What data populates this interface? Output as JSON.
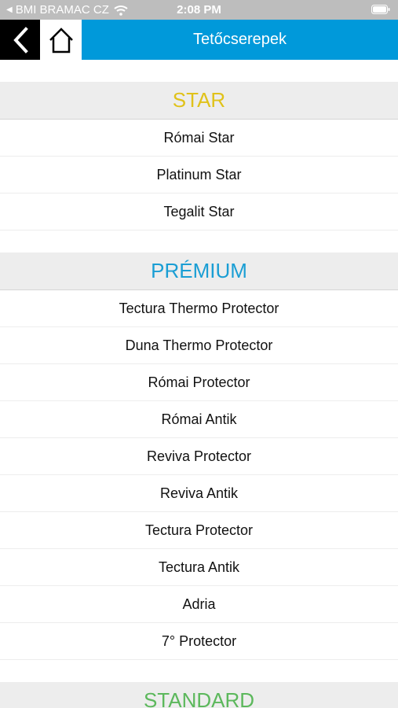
{
  "status_bar": {
    "carrier": "BMI BRAMAC CZ",
    "time": "2:08 PM"
  },
  "nav": {
    "title": "Tetőcserepek",
    "icons": [
      "chevron-left-icon",
      "home-icon"
    ]
  },
  "colors": {
    "accent": "#0099da",
    "star": "#e0c21a",
    "premium": "#1a9ed4",
    "standard": "#5cb85c"
  },
  "sections": [
    {
      "title": "STAR",
      "color": "#e0c21a",
      "items": [
        "Római Star",
        "Platinum Star",
        "Tegalit Star"
      ]
    },
    {
      "title": "PRÉMIUM",
      "color": "#1a9ed4",
      "items": [
        "Tectura Thermo Protector",
        "Duna Thermo Protector",
        "Római Protector",
        "Római Antik",
        "Reviva Protector",
        "Reviva Antik",
        "Tectura Protector",
        "Tectura Antik",
        "Adria",
        "7° Protector"
      ]
    },
    {
      "title": "STANDARD",
      "color": "#5cb85c",
      "items": []
    }
  ]
}
